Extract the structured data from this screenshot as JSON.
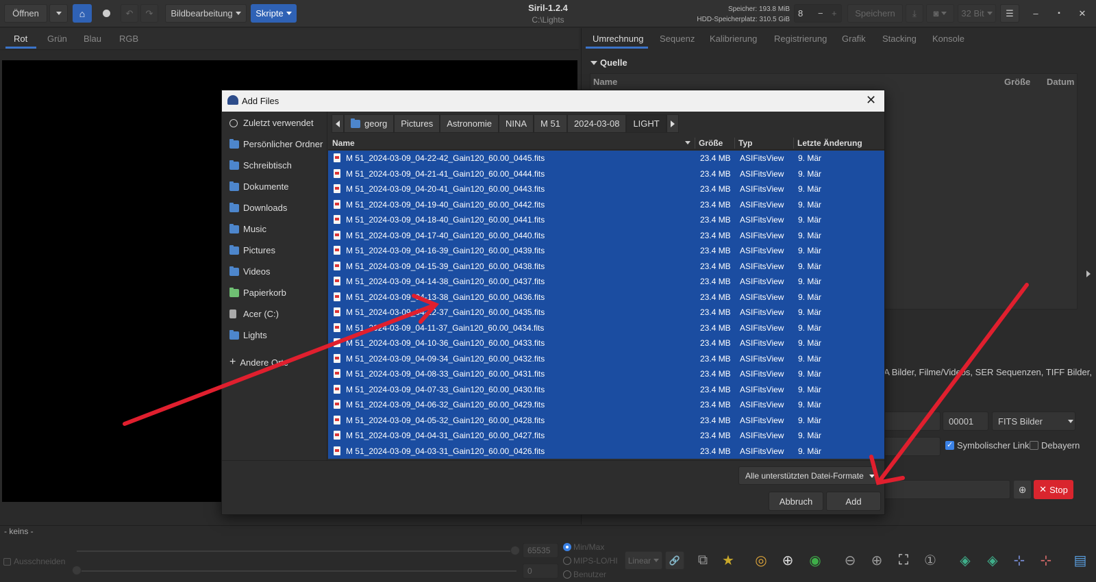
{
  "window": {
    "app_title": "Siril-1.2.4",
    "path": "C:\\Lights",
    "memory_label": "Speicher: 193.8 MiB",
    "disk_label": "HDD-Speicherplatz: 310.5 GiB"
  },
  "toolbar": {
    "open": "Öffnen",
    "image_processing": "Bildbearbeitung",
    "scripts": "Skripte",
    "threads": "8",
    "save": "Speichern",
    "bit_depth": "32 Bit"
  },
  "left_tabs": [
    "Rot",
    "Grün",
    "Blau",
    "RGB"
  ],
  "right_tabs": [
    "Umrechnung",
    "Sequenz",
    "Kalibrierung",
    "Registrierung",
    "Grafik",
    "Stacking",
    "Konsole"
  ],
  "conversion": {
    "section": "Quelle",
    "col_name": "Name",
    "col_size": "Größe",
    "col_date": "Datum",
    "formats_text": "FA Bilder, Filme/Videos, SER Sequenzen, TIFF Bilder,",
    "index": "00001",
    "output_format": "FITS Bilder",
    "symlink": "Symbolischer Link",
    "symlink_checked": true,
    "debayer": "Debayern",
    "stop": "Stop"
  },
  "bottom": {
    "preview_label": "- keins -",
    "crop": "Ausschneiden",
    "max_value": "65535",
    "min_value": "0",
    "radio_minmax": "Min/Max",
    "radio_mips": "MIPS-LO/HI",
    "radio_user": "Benutzer",
    "stretch": "Linear"
  },
  "dialog": {
    "title": "Add Files",
    "places": [
      {
        "label": "Zuletzt verwendet",
        "icon": "clock-icon"
      },
      {
        "label": "Persönlicher Ordner",
        "icon": "folder-icon"
      },
      {
        "label": "Schreibtisch",
        "icon": "folder-icon"
      },
      {
        "label": "Dokumente",
        "icon": "folder-icon"
      },
      {
        "label": "Downloads",
        "icon": "folder-icon"
      },
      {
        "label": "Music",
        "icon": "folder-icon"
      },
      {
        "label": "Pictures",
        "icon": "folder-icon"
      },
      {
        "label": "Videos",
        "icon": "folder-icon"
      },
      {
        "label": "Papierkorb",
        "icon": "trash-icon"
      },
      {
        "label": "Acer (C:)",
        "icon": "drive-icon"
      },
      {
        "label": "Lights",
        "icon": "folder-icon"
      },
      {
        "label": "Andere Orte",
        "icon": "plus-icon"
      }
    ],
    "path": [
      "georg",
      "Pictures",
      "Astronomie",
      "NINA",
      "M 51",
      "2024-03-08",
      "LIGHT"
    ],
    "columns": {
      "name": "Name",
      "size": "Größe",
      "type": "Typ",
      "modified": "Letzte Änderung"
    },
    "files": [
      {
        "name": "M 51_2024-03-09_04-22-42_Gain120_60.00_0445.fits",
        "size": "23.4 MB",
        "type": "ASIFitsView",
        "modified": "9. Mär"
      },
      {
        "name": "M 51_2024-03-09_04-21-41_Gain120_60.00_0444.fits",
        "size": "23.4 MB",
        "type": "ASIFitsView",
        "modified": "9. Mär"
      },
      {
        "name": "M 51_2024-03-09_04-20-41_Gain120_60.00_0443.fits",
        "size": "23.4 MB",
        "type": "ASIFitsView",
        "modified": "9. Mär"
      },
      {
        "name": "M 51_2024-03-09_04-19-40_Gain120_60.00_0442.fits",
        "size": "23.4 MB",
        "type": "ASIFitsView",
        "modified": "9. Mär"
      },
      {
        "name": "M 51_2024-03-09_04-18-40_Gain120_60.00_0441.fits",
        "size": "23.4 MB",
        "type": "ASIFitsView",
        "modified": "9. Mär"
      },
      {
        "name": "M 51_2024-03-09_04-17-40_Gain120_60.00_0440.fits",
        "size": "23.4 MB",
        "type": "ASIFitsView",
        "modified": "9. Mär"
      },
      {
        "name": "M 51_2024-03-09_04-16-39_Gain120_60.00_0439.fits",
        "size": "23.4 MB",
        "type": "ASIFitsView",
        "modified": "9. Mär"
      },
      {
        "name": "M 51_2024-03-09_04-15-39_Gain120_60.00_0438.fits",
        "size": "23.4 MB",
        "type": "ASIFitsView",
        "modified": "9. Mär"
      },
      {
        "name": "M 51_2024-03-09_04-14-38_Gain120_60.00_0437.fits",
        "size": "23.4 MB",
        "type": "ASIFitsView",
        "modified": "9. Mär"
      },
      {
        "name": "M 51_2024-03-09_04-13-38_Gain120_60.00_0436.fits",
        "size": "23.4 MB",
        "type": "ASIFitsView",
        "modified": "9. Mär"
      },
      {
        "name": "M 51_2024-03-09_04-12-37_Gain120_60.00_0435.fits",
        "size": "23.4 MB",
        "type": "ASIFitsView",
        "modified": "9. Mär"
      },
      {
        "name": "M 51_2024-03-09_04-11-37_Gain120_60.00_0434.fits",
        "size": "23.4 MB",
        "type": "ASIFitsView",
        "modified": "9. Mär"
      },
      {
        "name": "M 51_2024-03-09_04-10-36_Gain120_60.00_0433.fits",
        "size": "23.4 MB",
        "type": "ASIFitsView",
        "modified": "9. Mär"
      },
      {
        "name": "M 51_2024-03-09_04-09-34_Gain120_60.00_0432.fits",
        "size": "23.4 MB",
        "type": "ASIFitsView",
        "modified": "9. Mär"
      },
      {
        "name": "M 51_2024-03-09_04-08-33_Gain120_60.00_0431.fits",
        "size": "23.4 MB",
        "type": "ASIFitsView",
        "modified": "9. Mär"
      },
      {
        "name": "M 51_2024-03-09_04-07-33_Gain120_60.00_0430.fits",
        "size": "23.4 MB",
        "type": "ASIFitsView",
        "modified": "9. Mär"
      },
      {
        "name": "M 51_2024-03-09_04-06-32_Gain120_60.00_0429.fits",
        "size": "23.4 MB",
        "type": "ASIFitsView",
        "modified": "9. Mär"
      },
      {
        "name": "M 51_2024-03-09_04-05-32_Gain120_60.00_0428.fits",
        "size": "23.4 MB",
        "type": "ASIFitsView",
        "modified": "9. Mär"
      },
      {
        "name": "M 51_2024-03-09_04-04-31_Gain120_60.00_0427.fits",
        "size": "23.4 MB",
        "type": "ASIFitsView",
        "modified": "9. Mär"
      },
      {
        "name": "M 51_2024-03-09_04-03-31_Gain120_60.00_0426.fits",
        "size": "23.4 MB",
        "type": "ASIFitsView",
        "modified": "9. Mär"
      }
    ],
    "filter": "Alle unterstützten Datei-Formate",
    "cancel": "Abbruch",
    "add": "Add"
  },
  "colors": {
    "accent": "#3b73c8",
    "selection": "#1b4da1",
    "stop": "#d9252e",
    "annotation_arrow": "#e01f2e"
  }
}
